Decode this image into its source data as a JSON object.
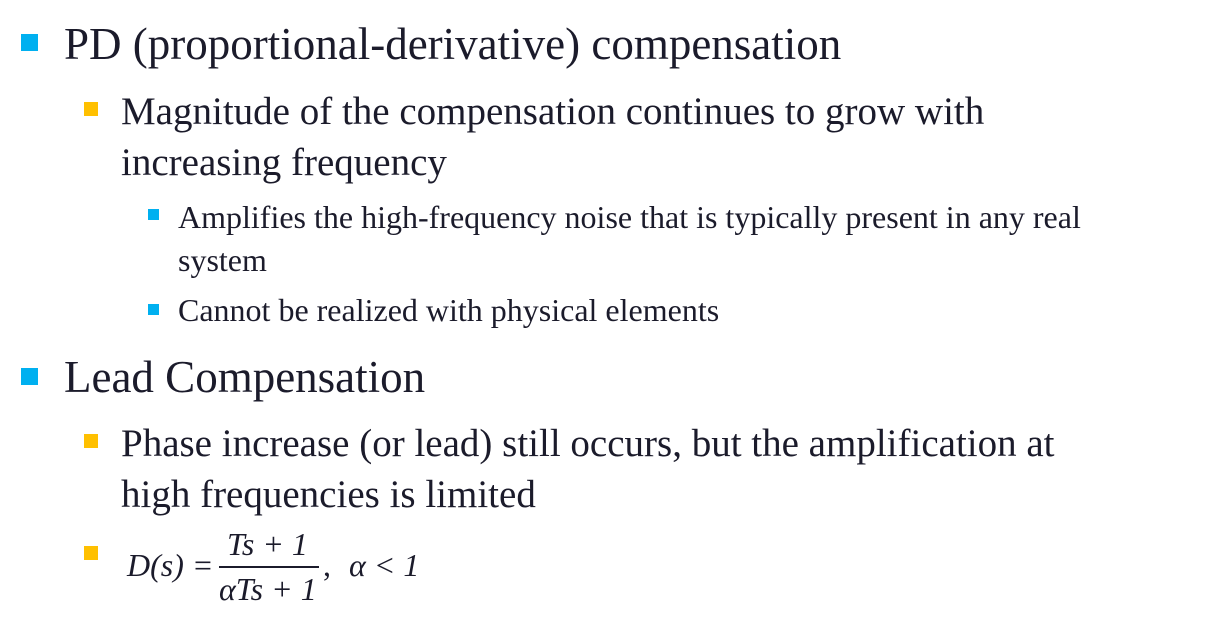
{
  "sections": [
    {
      "heading": "PD (proportional-derivative) compensation",
      "sub": [
        {
          "line1": "Magnitude of the compensation continues to grow with",
          "line2": "increasing frequency",
          "subsub": [
            {
              "line1": "Amplifies the high-frequency noise that is typically present in any real",
              "line2": "system"
            },
            {
              "line1": "Cannot be realized with physical elements"
            }
          ]
        }
      ]
    },
    {
      "heading": "Lead Compensation",
      "sub": [
        {
          "line1": "Phase increase (or lead) still occurs, but the amplification at",
          "line2": "high frequencies is limited"
        }
      ]
    }
  ],
  "formula": {
    "lhs": "D(s) =",
    "numerator": "Ts + 1",
    "denominator": "αTs + 1",
    "comma": ",",
    "condition": "α < 1"
  },
  "colors": {
    "level1_bullet": "#00b0f0",
    "level2_bullet": "#ffc000",
    "level3_bullet": "#00b0f0",
    "text": "#1b1b2b"
  }
}
